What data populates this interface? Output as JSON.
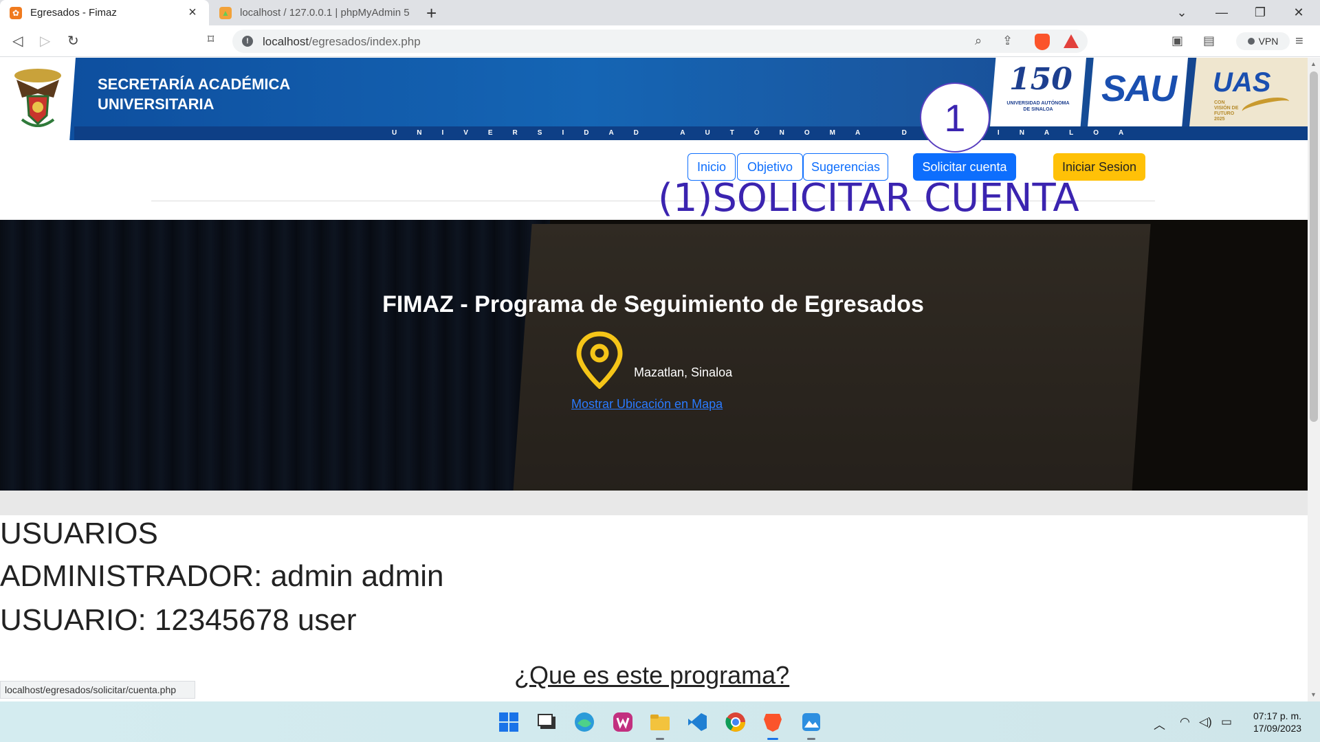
{
  "browser": {
    "tabs": [
      {
        "title": "Egresados - Fimaz",
        "active": true
      },
      {
        "title": "localhost / 127.0.0.1 | phpMyAdmin 5...",
        "active": false
      }
    ],
    "url_host": "localhost",
    "url_path": "/egresados/index.php",
    "vpn_label": "VPN",
    "status_url": "localhost/egresados/solicitar/cuenta.php"
  },
  "header": {
    "title_line1": "SECRETARÍA ACADÉMICA",
    "title_line2": "UNIVERSITARIA",
    "subtitle": "UNIVERSIDAD AUTÓNOMA DE SINALOA",
    "logo150_number": "150",
    "logo150_caption": "UNIVERSIDAD AUTÓNOMA DE SINALOA",
    "logo_sau": "SAU",
    "logo_uas": "UAS",
    "logo_uas_caption": "CON VISIÓN DE FUTURO 2025"
  },
  "annotation": {
    "step_number": "1",
    "text": "(1)SOLICITAR CUENTA"
  },
  "nav": {
    "links": [
      "Inicio",
      "Objetivo",
      "Sugerencias"
    ],
    "solicitar_label": "Solicitar cuenta",
    "login_label": "Iniciar Sesion"
  },
  "hero": {
    "title": "FIMAZ - Programa de Seguimiento de Egresados",
    "location": "Mazatlan, Sinaloa",
    "map_link": "Mostrar Ubicación en Mapa"
  },
  "users": {
    "heading": "USUARIOS",
    "admin_line": "ADMINISTRADOR: admin admin",
    "user_line": "USUARIO: 12345678 user"
  },
  "question": "¿Que es este programa?",
  "taskbar": {
    "time": "07:17 p. m.",
    "date": "17/09/2023"
  },
  "colors": {
    "primary": "#0d6efd",
    "warning": "#ffc107",
    "annotation": "#3b24b0",
    "header_blue": "#1565b4"
  }
}
